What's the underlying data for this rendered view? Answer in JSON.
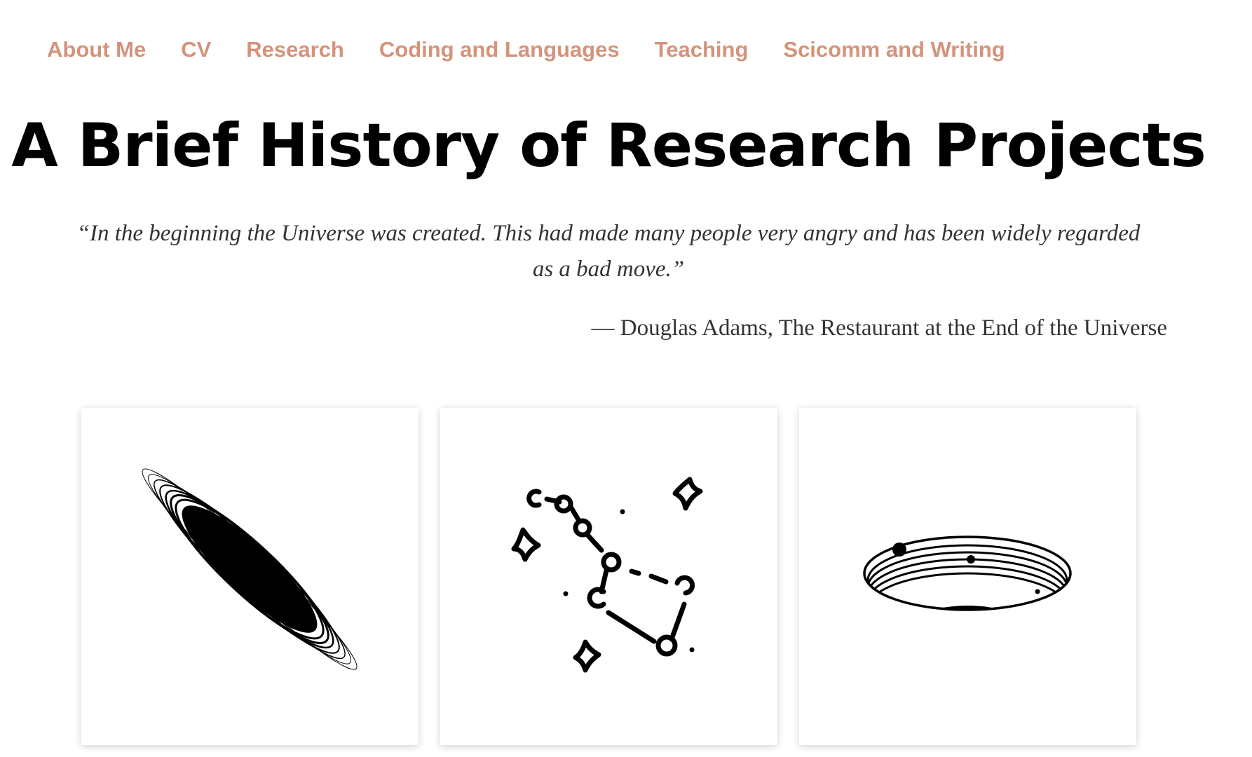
{
  "nav": {
    "items": [
      {
        "label": "About Me"
      },
      {
        "label": "CV"
      },
      {
        "label": "Research"
      },
      {
        "label": "Coding and Languages"
      },
      {
        "label": "Teaching"
      },
      {
        "label": "Scicomm and Writing"
      }
    ]
  },
  "header": {
    "title": "A Brief History of Research Projects"
  },
  "epigraph": {
    "quote": "“In the beginning the Universe was created. This had made many people very angry and has been widely regarded as a bad move.”",
    "attribution": "— Douglas Adams, The Restaurant at the End of the Universe"
  },
  "cards": [
    {
      "icon": "galaxy-icon"
    },
    {
      "icon": "constellation-icon"
    },
    {
      "icon": "planetary-disk-icon"
    }
  ],
  "colors": {
    "nav_link": "#d4937a",
    "title": "#000000",
    "body_text": "#333333",
    "icon_stroke": "#000000"
  }
}
